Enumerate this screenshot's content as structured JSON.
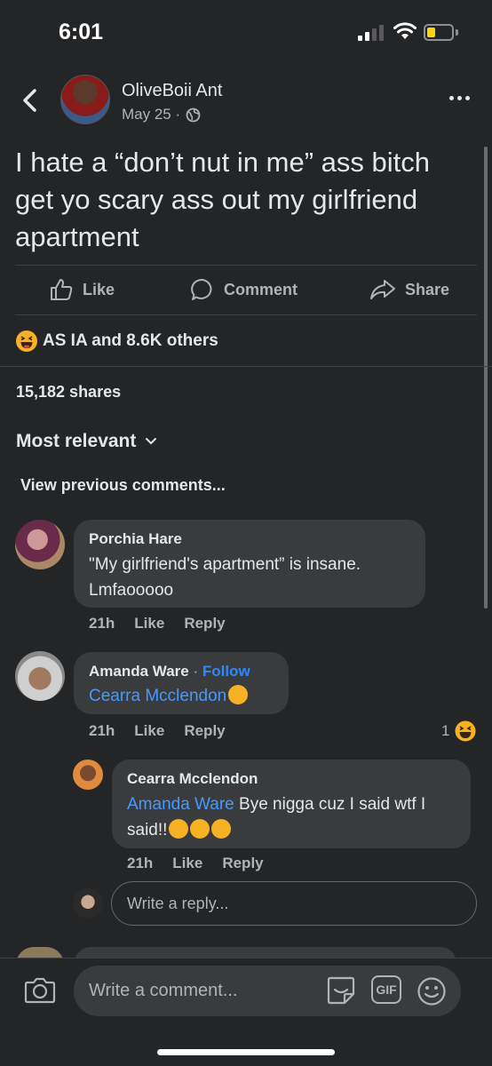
{
  "status_bar": {
    "time": "6:01"
  },
  "post": {
    "author": "OliveBoii Ant",
    "date": "May 25 ·",
    "text": "I hate a “don’t nut in me” ass bitch get yo scary ass out my girlfriend apartment",
    "actions": {
      "like": "Like",
      "comment": "Comment",
      "share": "Share"
    },
    "reactions_text": "AS IA and 8.6K others",
    "shares_text": "15,182 shares"
  },
  "comments_section": {
    "sort_label": "Most relevant",
    "view_previous": "View previous comments...",
    "comments": [
      {
        "name": "Porchia Hare",
        "text": "\"My girlfriend's apartment” is insane. Lmfaooooo",
        "time": "21h",
        "like": "Like",
        "reply": "Reply"
      },
      {
        "name": "Amanda Ware",
        "follow_sep": " · ",
        "follow": "Follow",
        "mention": "Cearra Mcclendon",
        "time": "21h",
        "like": "Like",
        "reply": "Reply",
        "reaction_count": "1"
      }
    ],
    "reply": {
      "name": "Cearra Mcclendon",
      "mention": "Amanda Ware",
      "text": " Bye nigga cuz I said wtf I said!!",
      "time": "21h",
      "like": "Like",
      "reply": "Reply"
    },
    "reply_placeholder": "Write a reply..."
  },
  "bottom_bar": {
    "comment_placeholder": "Write a comment...",
    "gif_label": "GIF"
  },
  "colors": {
    "background": "#242526",
    "bubble": "#3a3b3c",
    "link": "#4599ff",
    "haha": "#f7b125"
  }
}
